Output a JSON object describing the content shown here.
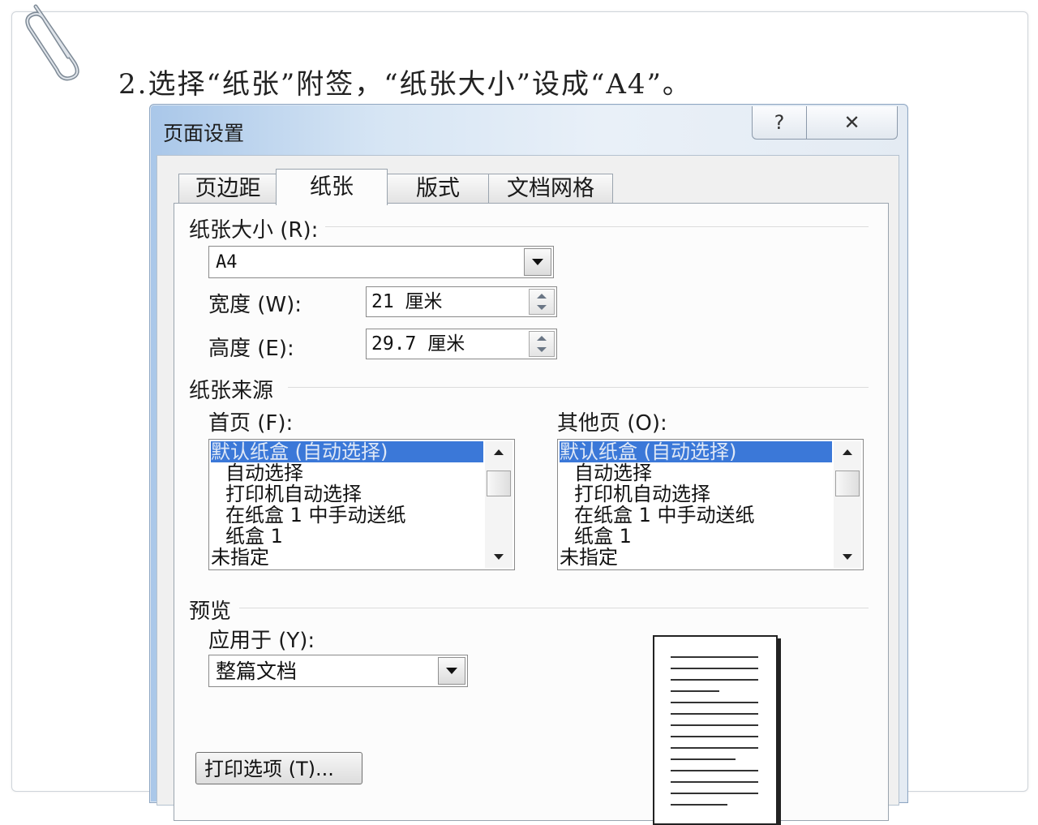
{
  "instruction": "2.选择“纸张”附签，“纸张大小”设成“A4”。",
  "dialog": {
    "title": "页面设置",
    "help_glyph": "?",
    "close_glyph": "✕",
    "tabs": [
      "页边距",
      "纸张",
      "版式",
      "文档网格"
    ],
    "active_tab": "纸张"
  },
  "paper_size": {
    "label": "纸张大小 (R):",
    "value": "A4",
    "width_label": "宽度 (W):",
    "width_value": "21 厘米",
    "height_label": "高度 (E):",
    "height_value": "29.7 厘米"
  },
  "paper_source": {
    "label": "纸张来源",
    "first_page_label": "首页 (F):",
    "other_pages_label": "其他页 (O):",
    "items": [
      "默认纸盒 (自动选择)",
      "自动选择",
      "打印机自动选择",
      "在纸盒 1 中手动送纸",
      "纸盒 1",
      "未指定"
    ]
  },
  "preview": {
    "label": "预览",
    "apply_to_label": "应用于 (Y):",
    "apply_to_value": "整篇文档"
  },
  "print_options_button": "打印选项 (T)..."
}
